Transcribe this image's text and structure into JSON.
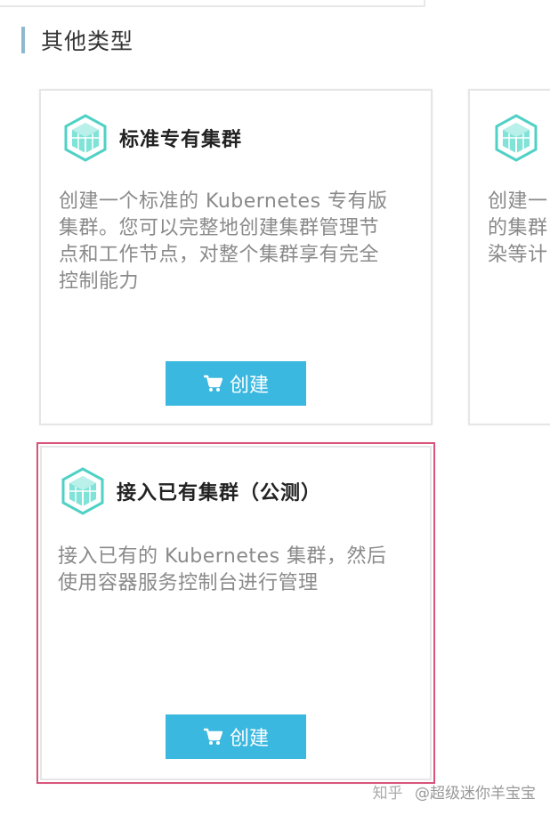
{
  "section": {
    "title": "其他类型"
  },
  "cards": [
    {
      "title": "标准专有集群",
      "description": "创建一个标准的 Kubernetes 专有版\n集群。您可以完整地创建集群管理节\n点和工作节点，对整个集群享有完全\n控制能力",
      "button_label": "创建"
    },
    {
      "title": "(",
      "description": "创建一\n的集群\n染等计",
      "button_label": ""
    },
    {
      "title": "接入已有集群（公测）",
      "description": "接入已有的 Kubernetes 集群，然后\n使用容器服务控制台进行管理",
      "button_label": "创建"
    }
  ],
  "watermark": {
    "site": "知乎",
    "user": "@超级迷你羊宝宝"
  },
  "colors": {
    "accent": "#3bb8e0",
    "selected_border": "#d9547a",
    "section_bar": "#8fb8cf",
    "icon": "#4fd1c5"
  }
}
